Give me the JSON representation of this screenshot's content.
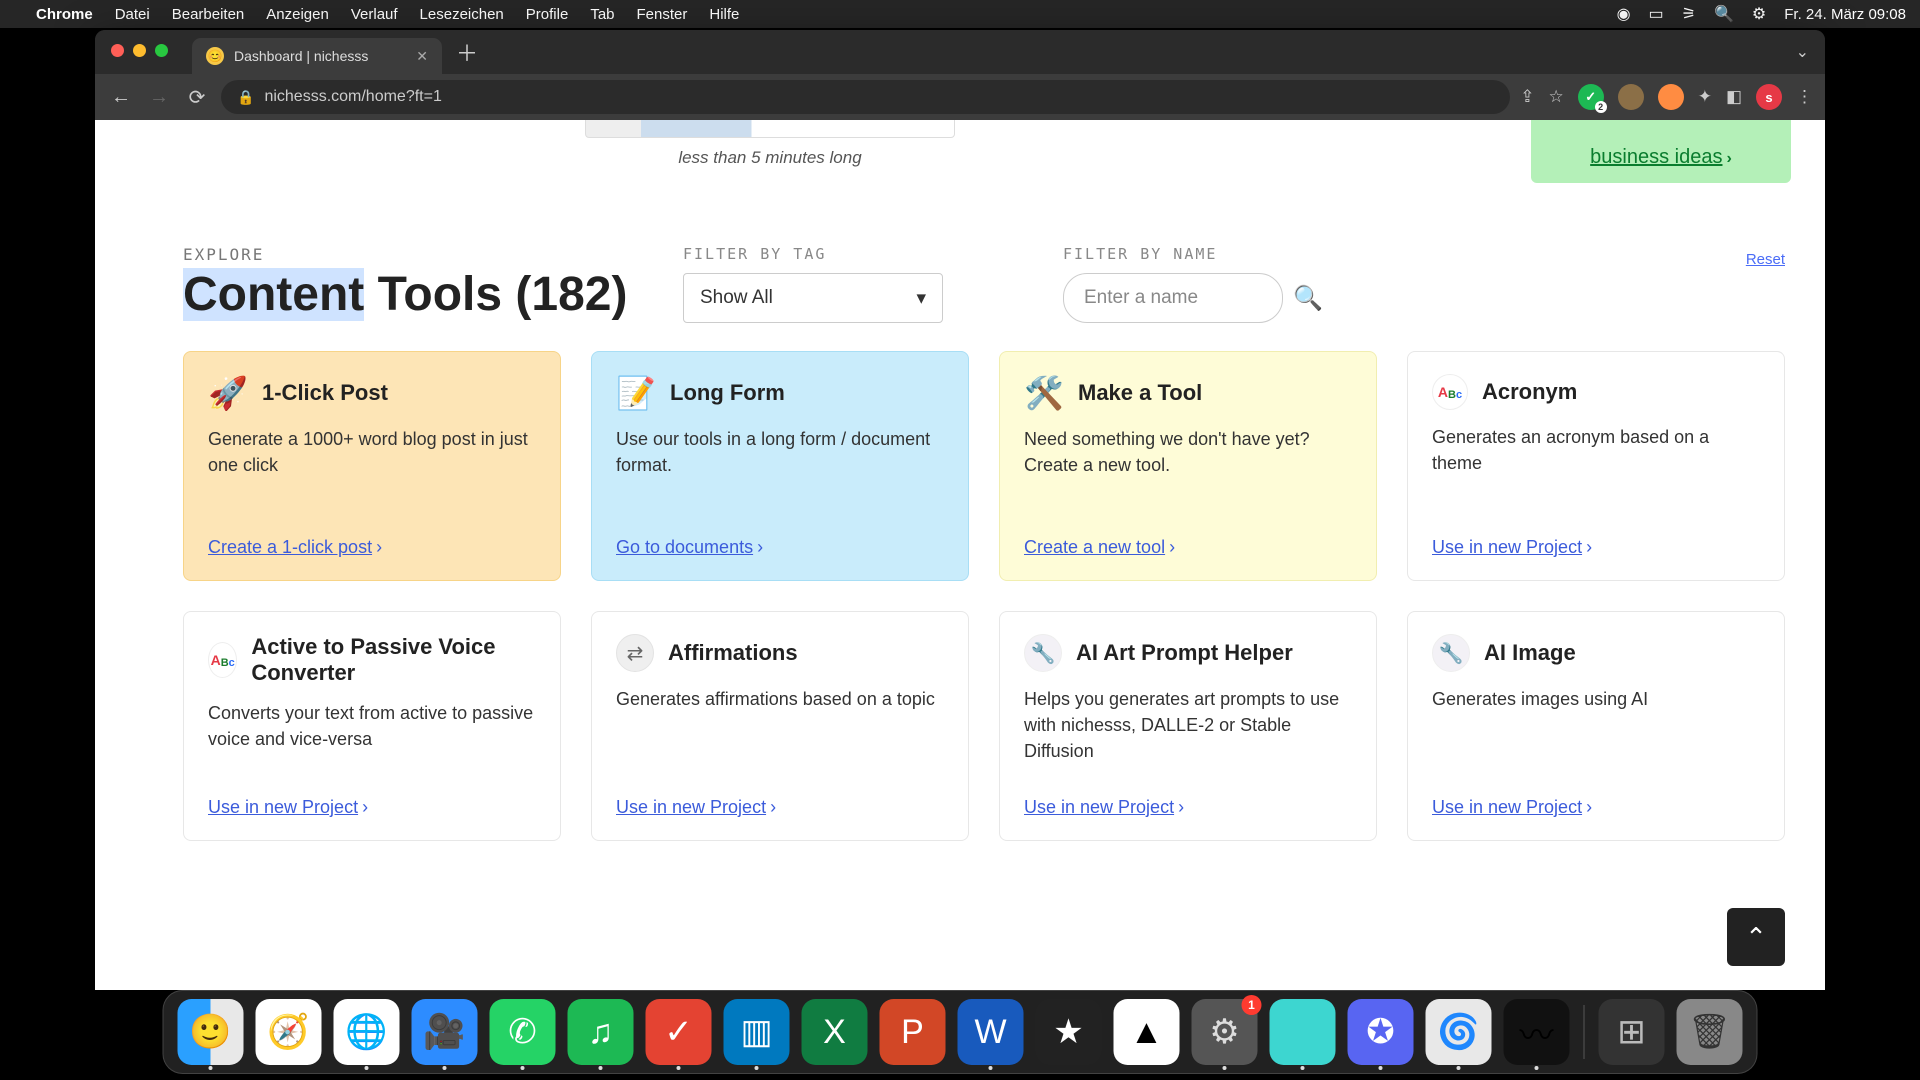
{
  "menubar": {
    "app": "Chrome",
    "items": [
      "Datei",
      "Bearbeiten",
      "Anzeigen",
      "Verlauf",
      "Lesezeichen",
      "Profile",
      "Tab",
      "Fenster",
      "Hilfe"
    ],
    "clock": "Fr. 24. März 09:08"
  },
  "browser": {
    "tab_title": "Dashboard | nichesss",
    "url": "nichesss.com/home?ft=1"
  },
  "top": {
    "video_caption": "less than 5 minutes long",
    "biz_link": "business ideas"
  },
  "filters": {
    "explore_label": "EXPLORE",
    "title_hl": "Content",
    "title_rest": " Tools (182)",
    "tag_label": "FILTER BY TAG",
    "tag_value": "Show All",
    "name_label": "FILTER BY NAME",
    "reset": "Reset",
    "search_placeholder": "Enter a name"
  },
  "cards": [
    {
      "id": "oneclick",
      "bg": "orange",
      "icon": "🚀",
      "title": "1-Click Post",
      "desc": "Generate a 1000+ word blog post in just one click",
      "link": "Create a 1-click post"
    },
    {
      "id": "longform",
      "bg": "blue",
      "icon": "📝",
      "title": "Long Form",
      "desc": "Use our tools in a long form / document format.",
      "link": "Go to documents"
    },
    {
      "id": "makeatool",
      "bg": "yellow",
      "icon": "🛠️",
      "title": "Make a Tool",
      "desc": "Need something we don't have yet? Create a new tool.",
      "link": "Create a new tool"
    },
    {
      "id": "acronym",
      "bg": "",
      "icon": "abc",
      "title": "Acronym",
      "desc": "Generates an acronym based on a theme",
      "link": "Use in new Project"
    },
    {
      "id": "active",
      "bg": "",
      "icon": "abc",
      "title": "Active to Passive Voice Converter",
      "desc": "Converts your text from active to passive voice and vice-versa",
      "link": "Use in new Project"
    },
    {
      "id": "affirm",
      "bg": "",
      "icon": "gray-arrows",
      "title": "Affirmations",
      "desc": "Generates affirmations based on a topic",
      "link": "Use in new Project"
    },
    {
      "id": "aiart",
      "bg": "",
      "icon": "wrench",
      "title": "AI Art Prompt Helper",
      "desc": "Helps you generates art prompts to use with nichesss, DALLE-2 or Stable Diffusion",
      "link": "Use in new Project"
    },
    {
      "id": "aiimage",
      "bg": "",
      "icon": "wrench",
      "title": "AI Image",
      "desc": "Generates images using AI",
      "link": "Use in new Project"
    }
  ],
  "dock": {
    "settings_badge": "1"
  }
}
